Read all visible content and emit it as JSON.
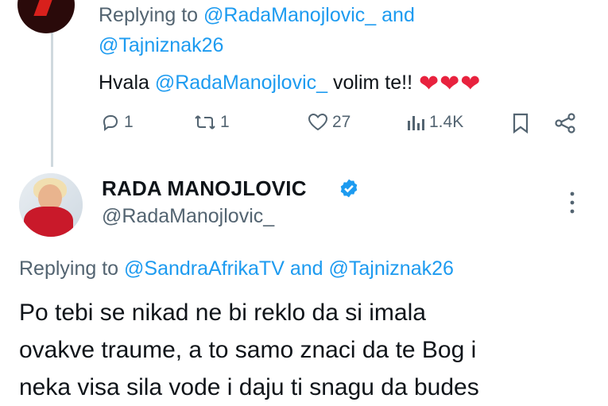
{
  "reply_tweet": {
    "replying_prefix": "Replying to",
    "replying_handle_1": "@RadaManojlovic_",
    "replying_and": "and",
    "replying_handle_2": "@Tajniznak26",
    "text_prefix": "Hvala",
    "text_mention": "@RadaManojlovic_",
    "text_suffix": "volim te!!",
    "emojis": [
      "❤",
      "❤",
      "❤"
    ],
    "actions": {
      "replies": "1",
      "retweets": "1",
      "likes": "27",
      "views": "1.4K"
    }
  },
  "main_tweet": {
    "author_name": "RADA MANOJLOVIC",
    "author_handle": "@RadaManojlovic_",
    "verified": true,
    "replying_prefix": "Replying to",
    "replying_handle_1": "@SandraAfrikaTV",
    "replying_and": "and",
    "replying_handle_2": "@Tajniznak26",
    "body_lines": [
      "Po tebi se nikad ne bi reklo da si imala",
      "ovakve traume, a to samo znaci da te Bog i",
      "neka visa sila vode i daju ti snagu da budes"
    ]
  },
  "colors": {
    "link": "#1d9bf0",
    "muted": "#536471",
    "verified_badge": "#1d9bf0",
    "heart": "#e8223e"
  },
  "icons": [
    "reply-icon",
    "retweet-icon",
    "like-icon",
    "views-icon",
    "bookmark-icon",
    "share-icon",
    "verified-icon",
    "more-icon"
  ]
}
